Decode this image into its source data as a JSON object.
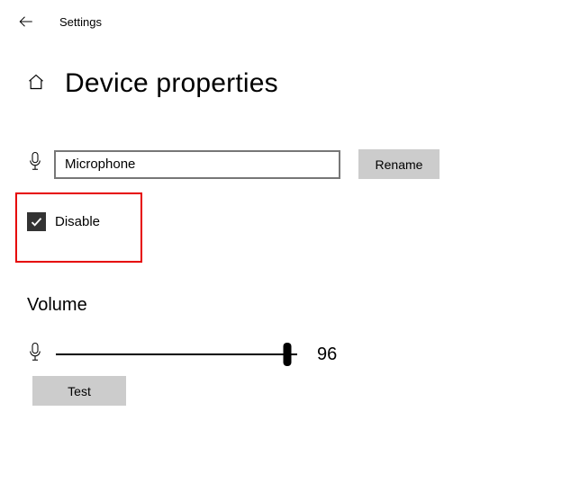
{
  "header": {
    "app_title": "Settings"
  },
  "page": {
    "title": "Device properties"
  },
  "device": {
    "name_value": "Microphone",
    "rename_label": "Rename"
  },
  "disable": {
    "label": "Disable",
    "checked": true
  },
  "volume": {
    "title": "Volume",
    "value": 96,
    "min": 0,
    "max": 100,
    "test_label": "Test"
  }
}
